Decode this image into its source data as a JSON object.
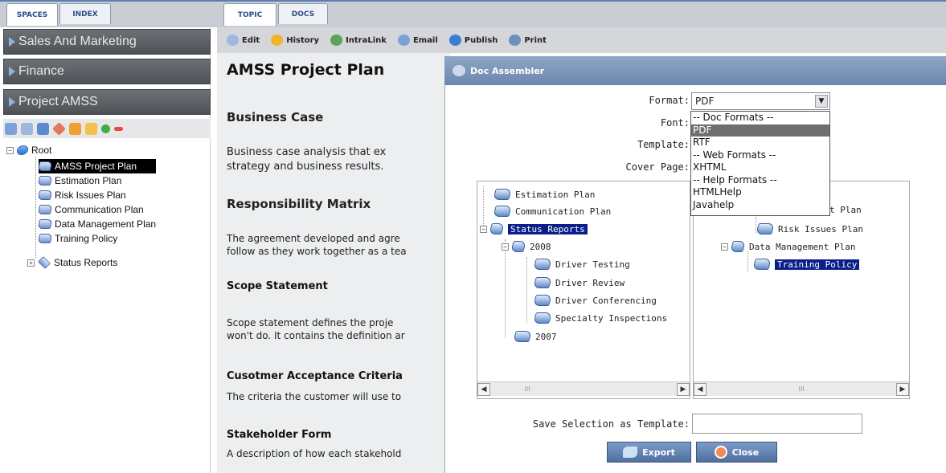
{
  "left": {
    "tabs": [
      "SPACES",
      "INDEX"
    ],
    "spaces": [
      "Sales And Marketing",
      "Finance",
      "Project AMSS"
    ],
    "tree": {
      "root": "Root",
      "items": [
        "AMSS Project Plan",
        "Estimation Plan",
        "Risk Issues Plan",
        "Communication Plan",
        "Data Management Plan",
        "Training Policy",
        "Status Reports"
      ]
    }
  },
  "right": {
    "tabs": [
      "TOPIC",
      "DOCS"
    ],
    "toolbar": [
      "Edit",
      "History",
      "IntraLink",
      "Email",
      "Publish",
      "Print"
    ]
  },
  "doc": {
    "title": "AMSS Project Plan",
    "sections": [
      {
        "heading": "Business Case",
        "lines": [
          "Business case analysis that ex",
          "strategy and business results."
        ]
      },
      {
        "heading": "Responsibility Matrix",
        "lines": [
          "The agreement developed and agre",
          "follow as they work together as a tea"
        ]
      },
      {
        "heading": "Scope Statement",
        "lines": [
          "Scope statement defines the proje",
          "won't do. It contains the definition ar"
        ]
      },
      {
        "heading": "Cusotmer Acceptance Criteria",
        "lines": [
          "The criteria the customer will use to"
        ]
      },
      {
        "heading": "Stakeholder Form",
        "lines": [
          "A description of how each stakehold"
        ]
      }
    ]
  },
  "dialog": {
    "title": "Doc Assembler",
    "labels": {
      "format": "Format:",
      "font": "Font:",
      "template": "Template:",
      "cover": "Cover Page:"
    },
    "format_value": "PDF",
    "format_options": [
      "-- Doc Formats --",
      "PDF",
      "RTF",
      "-- Web Formats --",
      "XHTML",
      "-- Help Formats --",
      "HTMLHelp",
      "Javahelp"
    ],
    "left_tree": [
      "Estimation Plan",
      "Communication Plan",
      "Status Reports",
      "2008",
      "Driver Testing",
      "Driver Review",
      "Driver Conferencing",
      "Specialty Inspections",
      "2007"
    ],
    "right_tree": [
      "t Plan",
      "Risk Issues Plan",
      "Data Management Plan",
      "Training Policy"
    ],
    "save_label": "Save Selection as Template:",
    "save_value": "",
    "export_label": "Export",
    "close_label": "Close",
    "scroll_mark": "III"
  }
}
